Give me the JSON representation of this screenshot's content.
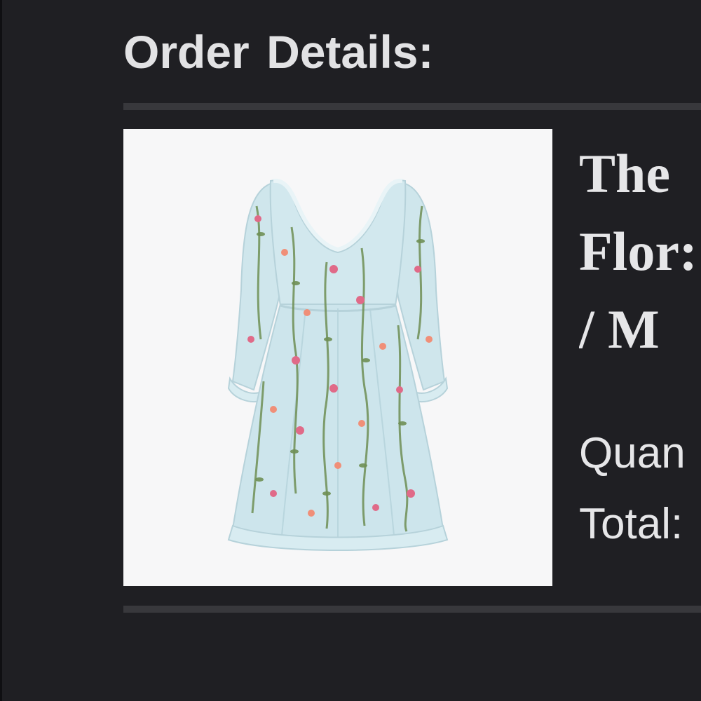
{
  "order": {
    "heading": "Order Details:"
  },
  "product": {
    "title_lines": [
      "The",
      "Flor:",
      "/ M"
    ],
    "image_alt": "Light blue floral print mini dress with long ruffled sleeves",
    "colors": {
      "dress": "#cfe6ec",
      "flower_pink": "#e06a88",
      "flower_coral": "#f08f78",
      "leaf": "#6f8f55"
    }
  },
  "summary": {
    "quantity_label": "Quan",
    "total_label": "Total:"
  },
  "colors": {
    "background": "#1f1f23",
    "divider": "#38383c",
    "text": "#e6e6e8",
    "image_background": "#f7f7f8"
  }
}
